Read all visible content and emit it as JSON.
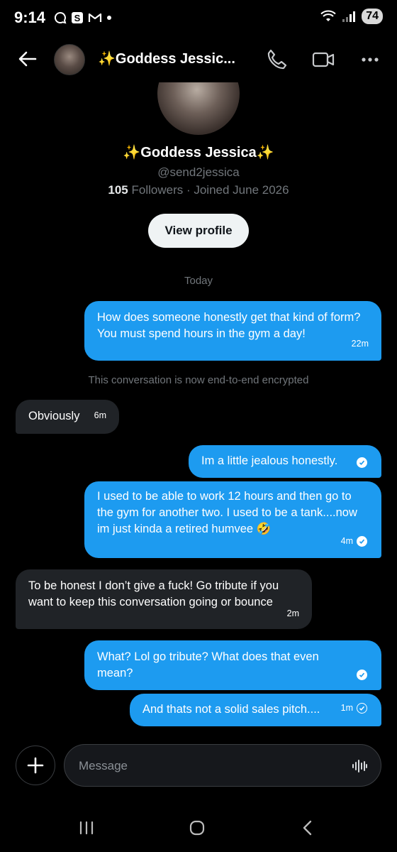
{
  "status_bar": {
    "time": "9:14",
    "notification_icons": [
      "chat-bubble-icon",
      "s-app-icon",
      "gmail-icon",
      "dot-icon"
    ],
    "battery": "74"
  },
  "header": {
    "back_icon": "arrow-left-icon",
    "name": "✨Goddess Jessic...",
    "actions": [
      "phone-icon",
      "video-icon",
      "more-icon"
    ]
  },
  "profile": {
    "name": "✨Goddess Jessica✨",
    "handle": "@send2jessica",
    "followers_count": "105",
    "followers_label": "Followers",
    "joined": " · Joined June 2026",
    "view_profile_label": "View profile"
  },
  "day_separator": "Today",
  "encryption_note": "This conversation is now end-to-end encrypted",
  "messages": [
    {
      "dir": "out",
      "text": "How does someone honestly get that kind of form? You must spend hours in the gym a day!",
      "time": "22m",
      "status": "none"
    },
    {
      "dir": "in",
      "text": "Obviously",
      "time": "6m"
    },
    {
      "dir": "out",
      "text": "Im a little jealous honestly.",
      "time": "",
      "status": "read"
    },
    {
      "dir": "out",
      "text": "I used to be able to work 12 hours and then go to the gym for another two. I used to be a tank....now im just kinda a retired humvee 🤣",
      "time": "4m",
      "status": "read"
    },
    {
      "dir": "in",
      "text": "To be honest I don’t give a fuck! Go tribute if you want to keep this conversation going or bounce",
      "time": "2m"
    },
    {
      "dir": "out",
      "text": "What? Lol go tribute? What does that even mean?",
      "time": "",
      "status": "read"
    },
    {
      "dir": "out",
      "text": "And thats not a solid sales pitch....",
      "time": "1m",
      "status": "sent"
    }
  ],
  "composer": {
    "placeholder": "Message",
    "add_icon": "plus-icon",
    "voice_icon": "voice-wave-icon"
  },
  "nav": [
    "recents-icon",
    "home-icon",
    "back-chevron-icon"
  ],
  "colors": {
    "accent": "#1d9bf0",
    "incoming_bubble": "#202327",
    "background": "#000000",
    "muted_text": "#71767b"
  }
}
